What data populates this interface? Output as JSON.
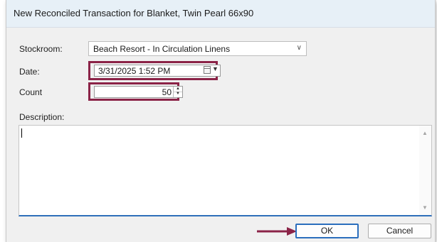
{
  "dialog": {
    "title": "New Reconciled Transaction for Blanket, Twin Pearl 66x90"
  },
  "form": {
    "stockroom_label": "Stockroom:",
    "stockroom_value": "Beach Resort - In Circulation Linens",
    "date_label": "Date:",
    "date_value": "3/31/2025   1:52 PM",
    "count_label": "Count",
    "count_value": "50",
    "description_label": "Description:",
    "description_value": ""
  },
  "buttons": {
    "ok_label": "OK",
    "cancel_label": "Cancel"
  },
  "colors": {
    "highlight": "#8b2347",
    "focus_blue": "#2b6ebd"
  },
  "icons": {
    "stockroom_dropdown": "chevron-down-icon",
    "date_picker": "calendar-icon",
    "annotation": "arrow-right-icon"
  }
}
